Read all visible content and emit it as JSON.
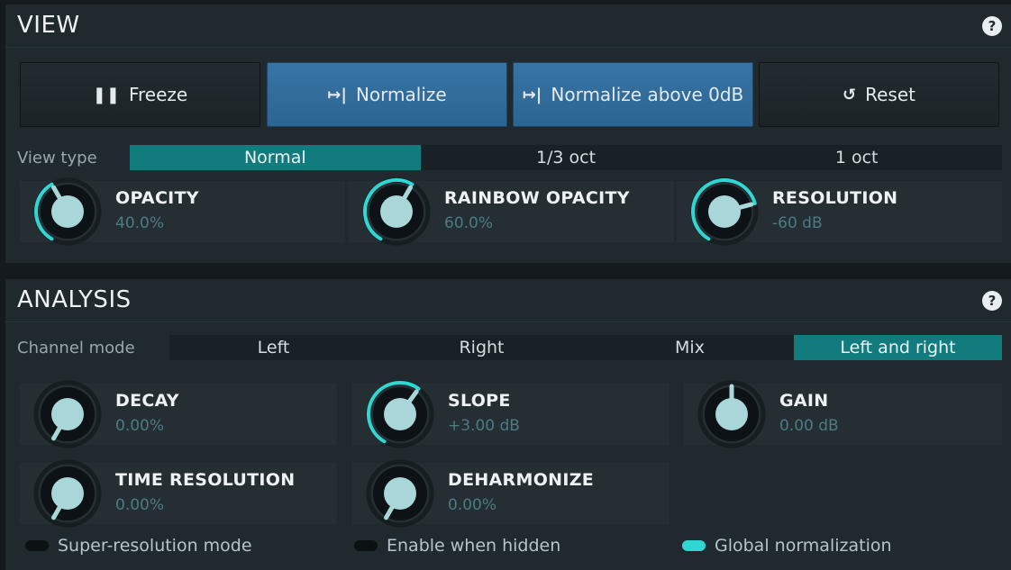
{
  "view": {
    "title": "VIEW",
    "help": "?",
    "buttons": [
      {
        "label": "Freeze",
        "glyph": "❚❚",
        "active": false
      },
      {
        "label": "Normalize",
        "glyph": "↦|",
        "active": true
      },
      {
        "label": "Normalize above 0dB",
        "glyph": "↦|",
        "active": true
      },
      {
        "label": "Reset",
        "glyph": "↺",
        "active": false
      }
    ],
    "view_type": {
      "label": "View type",
      "options": [
        "Normal",
        "1/3 oct",
        "1 oct"
      ],
      "selected": "Normal"
    },
    "knobs": [
      {
        "name": "OPACITY",
        "value": "40.0%",
        "level": 0.4
      },
      {
        "name": "RAINBOW OPACITY",
        "value": "60.0%",
        "level": 0.6
      },
      {
        "name": "RESOLUTION",
        "value": "-60 dB",
        "level": 0.75
      }
    ]
  },
  "analysis": {
    "title": "ANALYSIS",
    "help": "?",
    "channel_mode": {
      "label": "Channel mode",
      "options": [
        "Left",
        "Right",
        "Mix",
        "Left and right"
      ],
      "selected": "Left and right"
    },
    "knobs": [
      {
        "name": "DECAY",
        "value": "0.00%",
        "level": 0.0
      },
      {
        "name": "SLOPE",
        "value": "+3.00 dB",
        "level": 0.62
      },
      {
        "name": "GAIN",
        "value": "0.00 dB",
        "level": 0.5
      },
      {
        "name": "TIME RESOLUTION",
        "value": "0.00%",
        "level": 0.0
      },
      {
        "name": "DEHARMONIZE",
        "value": "0.00%",
        "level": 0.0
      }
    ],
    "toggles": [
      {
        "label": "Super-resolution mode",
        "on": false
      },
      {
        "label": "Enable when hidden",
        "on": false
      },
      {
        "label": "Global normalization",
        "on": true
      }
    ]
  },
  "colors": {
    "accent_teal": "#127b7e",
    "knob_arc": "#2fd7d3",
    "active_button": "#3774a4",
    "value_text": "#4b7c83"
  }
}
